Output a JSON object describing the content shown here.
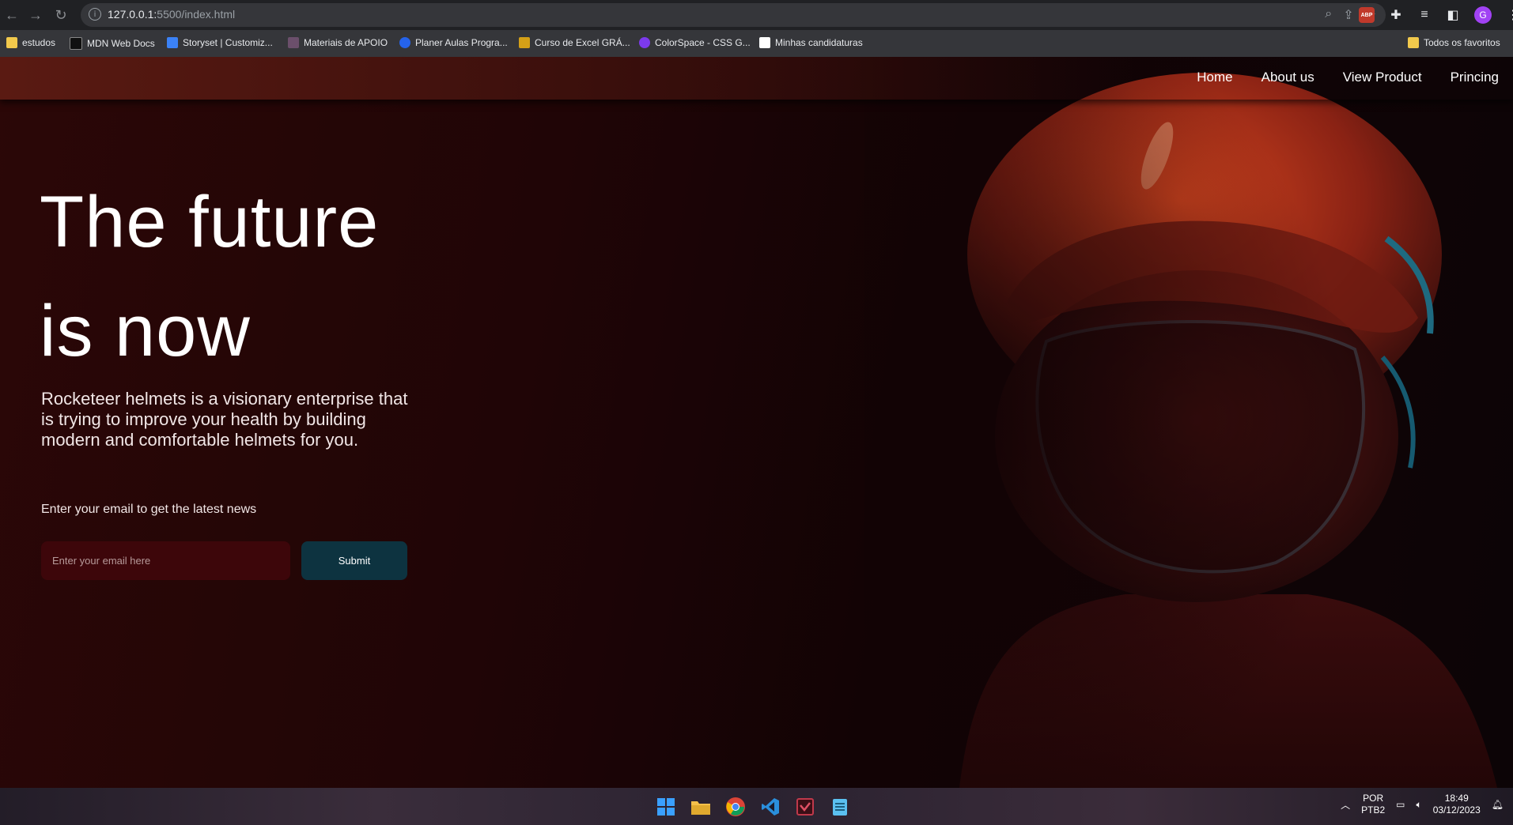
{
  "browser": {
    "url_host": "127.0.0.1:",
    "url_rest": "5500/index.html",
    "bookmarks": [
      {
        "label": "estudos",
        "icon": "folder-icon"
      },
      {
        "label": "MDN Web Docs",
        "icon": "mdn-icon"
      },
      {
        "label": "Storyset | Customiz...",
        "icon": "storyset-icon"
      },
      {
        "label": "Materiais de APOIO",
        "icon": "bookmark-icon"
      },
      {
        "label": "Planer Aulas Progra...",
        "icon": "bookmark-icon"
      },
      {
        "label": "Curso de Excel GRÁ...",
        "icon": "bookmark-icon"
      },
      {
        "label": "ColorSpace - CSS G...",
        "icon": "bookmark-icon"
      },
      {
        "label": "Minhas candidaturas",
        "icon": "bookmark-icon"
      }
    ],
    "all_bookmarks": "Todos os favoritos",
    "profile_initial": "G",
    "abp_label": "ABP"
  },
  "nav": {
    "items": [
      "Home",
      "About us",
      "View Product",
      "Princing"
    ]
  },
  "hero": {
    "title_line1": "The future",
    "title_line2": "is now",
    "description": "Rocketeer helmets is a visionary enterprise that is trying to improve your health by building modern and comfortable helmets for you.",
    "newsletter_label": "Enter your email to get the latest news",
    "email_placeholder": "Enter your email here",
    "submit_label": "Submit"
  },
  "taskbar": {
    "lang": "POR",
    "layout": "PTB2",
    "time": "18:49",
    "date": "03/12/2023"
  },
  "colors": {
    "accent_submit": "#0d3340",
    "input_bg": "#3d060a"
  }
}
